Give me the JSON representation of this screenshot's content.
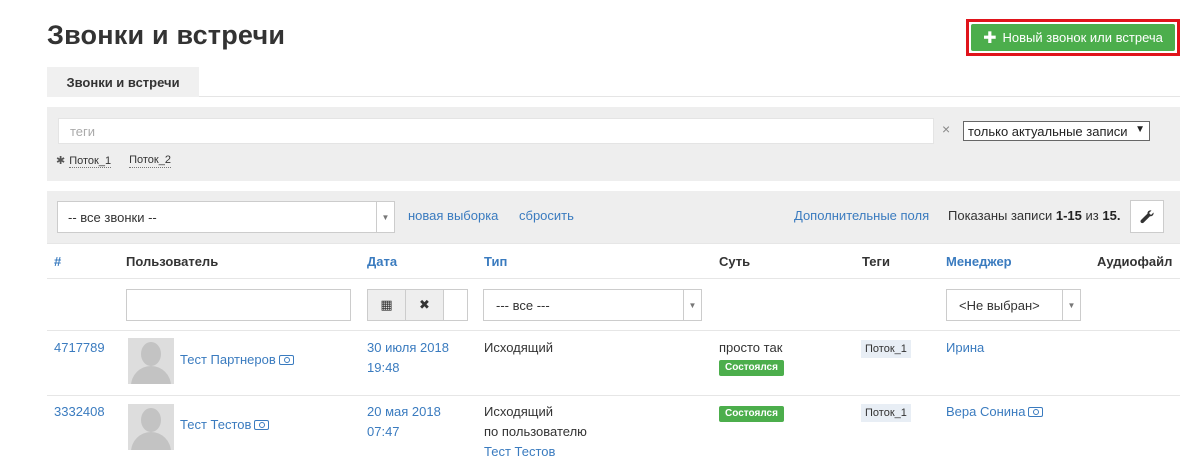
{
  "header": {
    "title": "Звонки и встречи",
    "new_button": "Новый звонок или встреча"
  },
  "tabs": [
    {
      "label": "Звонки и встречи"
    }
  ],
  "tags_panel": {
    "placeholder": "теги",
    "clear": "×",
    "scope_select": "только актуальные записи",
    "streams": [
      "Поток_1",
      "Поток_2"
    ]
  },
  "filters": {
    "calls_select": "-- все звонки --",
    "new_selection": "новая выборка",
    "reset": "сбросить",
    "extra_fields": "Дополнительные поля",
    "shown_prefix": "Показаны записи",
    "shown_range": "1-15",
    "shown_of": "из",
    "shown_total": "15."
  },
  "columns": {
    "num": "#",
    "user": "Пользователь",
    "date": "Дата",
    "type": "Тип",
    "essence": "Суть",
    "tags": "Теги",
    "manager": "Менеджер",
    "audio": "Аудиофайл"
  },
  "column_filters": {
    "type_select": "--- все ---",
    "manager_select": "<Не выбран>"
  },
  "rows": [
    {
      "id": "4717789",
      "user": "Тест Партнеров",
      "date": "30 июля 2018",
      "time": "19:48",
      "type_lines": [
        "Исходящий"
      ],
      "essence": "просто так",
      "status": "Состоялся",
      "tag": "Поток_1",
      "manager": "Ирина"
    },
    {
      "id": "3332408",
      "user": "Тест Тестов",
      "date": "20 мая 2018",
      "time": "07:47",
      "type_lines": [
        "Исходящий",
        "по пользователю",
        "Тест Тестов"
      ],
      "essence": "",
      "status": "Состоялся",
      "tag": "Поток_1",
      "manager": "Вера Сонина"
    }
  ]
}
